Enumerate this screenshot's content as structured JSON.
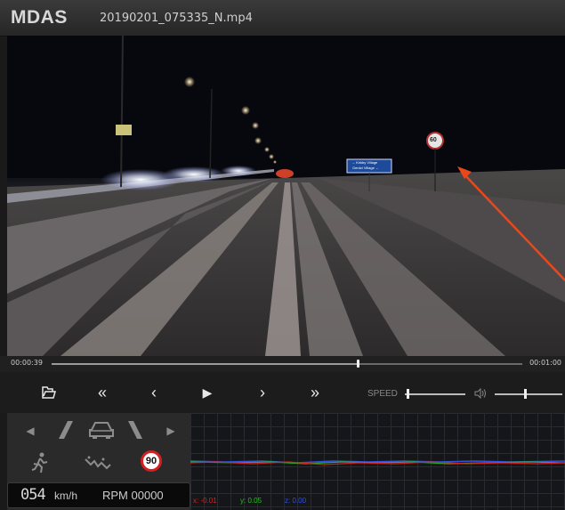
{
  "app": {
    "title": "MDAS",
    "file_name": "20190201_075335_N.mp4"
  },
  "video": {
    "sign_speed_limit": "60",
    "road_sign_lines": [
      "→ Kirkby Village",
      "Gerdzi Village ←"
    ],
    "annotation_arrow_color": "#e8481c"
  },
  "seek": {
    "current_time": "00:00:39",
    "total_time": "00:01:00",
    "progress": 0.65
  },
  "controls": {
    "open_icon": "folder-open-icon",
    "rewind_fast": "«",
    "prev": "‹",
    "play": "▶",
    "next": "›",
    "forward_fast": "»",
    "speed_label": "SPEED",
    "speed_level": 0.05,
    "volume_level": 0.45
  },
  "indicators": {
    "speed_limit": "90",
    "speed_value": "054",
    "speed_unit": "km/h",
    "rpm_label": "RPM 00000"
  },
  "graph": {
    "x_label": "x: -0.01",
    "y_label": "y: 0.05",
    "z_label": "z: 0.00",
    "x_color": "#e0201a",
    "y_color": "#22c21a",
    "z_color": "#3050e0"
  }
}
